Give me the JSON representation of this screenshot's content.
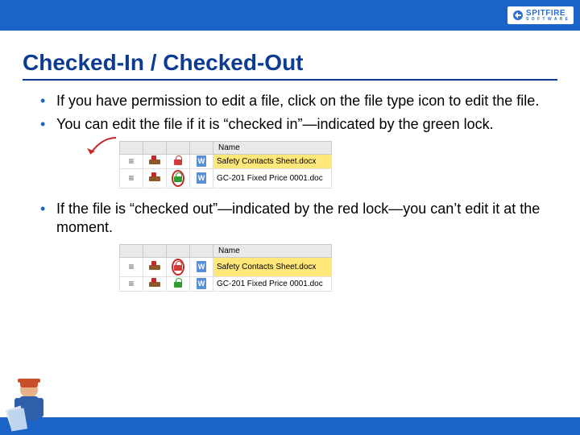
{
  "brand": "SPITFIRE",
  "brand_sub": "S O F T W A R E",
  "title": "Checked-In / Checked-Out",
  "bullets": [
    "If you have permission to edit a file, click on the file type icon to edit the file.",
    "You can edit the file if it is “checked in”—indicated by the green lock.",
    "If the file is “checked out”—indicated by the red lock—you can’t edit it at the moment."
  ],
  "table": {
    "header_name": "Name",
    "rows": [
      {
        "lock": "red",
        "doc": "W",
        "name": "Safety Contacts Sheet.docx",
        "selected": true
      },
      {
        "lock": "green",
        "doc": "W",
        "name": "GC-201 Fixed Price 0001.doc",
        "selected": false
      }
    ]
  }
}
